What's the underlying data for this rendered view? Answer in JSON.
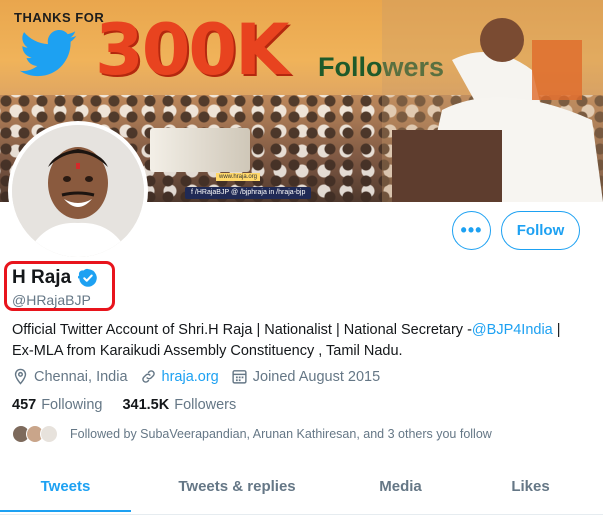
{
  "banner": {
    "thanks_text": "THANKS FOR",
    "headline": "300K",
    "followers_word": "Followers",
    "site_text": "www.hraja.org",
    "social_text": "f /HRajaBJP  @ /bjphraja  in /hraja-bjp",
    "accent_color": "#e8431f"
  },
  "profile": {
    "display_name": "H Raja",
    "handle": "@HRajaBJP",
    "verified": true,
    "bio_line1_prefix": "Official Twitter Account of Shri.H Raja | Nationalist | National Secretary -",
    "bio_mention": "@BJP4India",
    "bio_line1_suffix": " |",
    "bio_line2": "Ex-MLA from Karaikudi Assembly Constituency , Tamil Nadu.",
    "location": "Chennai, India",
    "website": "hraja.org",
    "joined": "Joined August 2015",
    "following_count": "457",
    "following_label": "Following",
    "followers_count": "341.5K",
    "followers_label": "Followers",
    "followed_by": "Followed by SubaVeerapandian, Arunan Kathiresan, and 3 others you follow"
  },
  "actions": {
    "more_label": "•••",
    "follow_label": "Follow"
  },
  "tabs": [
    {
      "label": "Tweets",
      "active": true
    },
    {
      "label": "Tweets & replies",
      "active": false
    },
    {
      "label": "Media",
      "active": false
    },
    {
      "label": "Likes",
      "active": false
    }
  ],
  "colors": {
    "twitter_blue": "#1da1f2",
    "highlight_red": "#e8141c",
    "secondary_text": "#657786"
  },
  "icons": [
    "twitter-bird-icon",
    "verified-badge-icon",
    "location-icon",
    "link-icon",
    "calendar-icon",
    "more-icon"
  ]
}
